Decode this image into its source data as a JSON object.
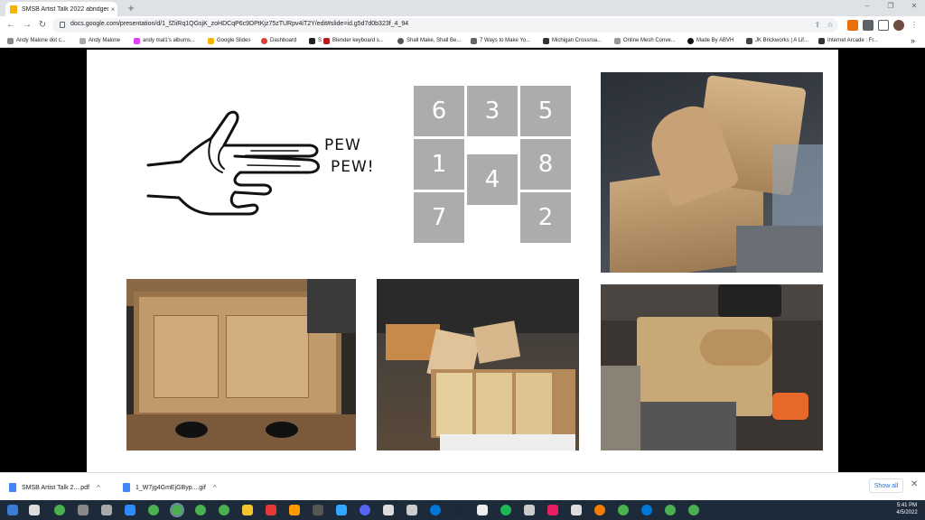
{
  "browser": {
    "tab_title": "SMSB Artist Talk 2022 abridged",
    "tab_close": "×",
    "new_tab": "+",
    "url": "docs.google.com/presentation/d/1_fZiiRq1QGsjK_zoHDCqP6c9DPtKjz75zTURpv4iT2Y/edit#slide=id.g5d7d0b323f_4_94",
    "back": "←",
    "forward": "→",
    "reload": "↻",
    "window_controls": {
      "minimize": "–",
      "restore": "❐",
      "close": "✕"
    },
    "bookmarks": [
      {
        "label": "Andy Malone dot c...",
        "color": "#888"
      },
      {
        "label": "Andy Malone",
        "color": "#aaa"
      },
      {
        "label": "andy mal1's albums...",
        "color": "#e040fb"
      },
      {
        "label": "Google Slides",
        "color": "#f4b400"
      },
      {
        "label": "Dashboard",
        "color": "#e53935"
      },
      {
        "label": "S",
        "color": "#222"
      },
      {
        "label": "Blender keyboard s...",
        "color": "#b71c1c"
      },
      {
        "label": "Shall Make, Shall Be...",
        "color": "#555"
      },
      {
        "label": "7 Ways to Make Yo...",
        "color": "#666"
      },
      {
        "label": "Michigan Crossroa...",
        "color": "#333"
      },
      {
        "label": "Online Mesh Conve...",
        "color": "#999"
      },
      {
        "label": "Made By ABVH",
        "color": "#111"
      },
      {
        "label": "JK Brickworks | A Lif...",
        "color": "#444"
      },
      {
        "label": "Internet Arcade : Fr...",
        "color": "#333"
      }
    ],
    "more_bookmarks": "»"
  },
  "slide": {
    "pew_line1": "PEW",
    "pew_line2": "PEW!",
    "grid_numbers": [
      "6",
      "3",
      "5",
      "1",
      "8",
      "4",
      "7",
      "2"
    ]
  },
  "downloads": {
    "items": [
      {
        "label": "SMSB Artist Talk 2....pdf",
        "color": "#4285f4"
      },
      {
        "label": "1_W7jg4GmEjGByp....gif",
        "color": "#4285f4"
      }
    ],
    "show_all": "Show all",
    "close": "✕"
  },
  "taskbar": {
    "time": "5:41 PM",
    "date": "4/5/2022"
  }
}
